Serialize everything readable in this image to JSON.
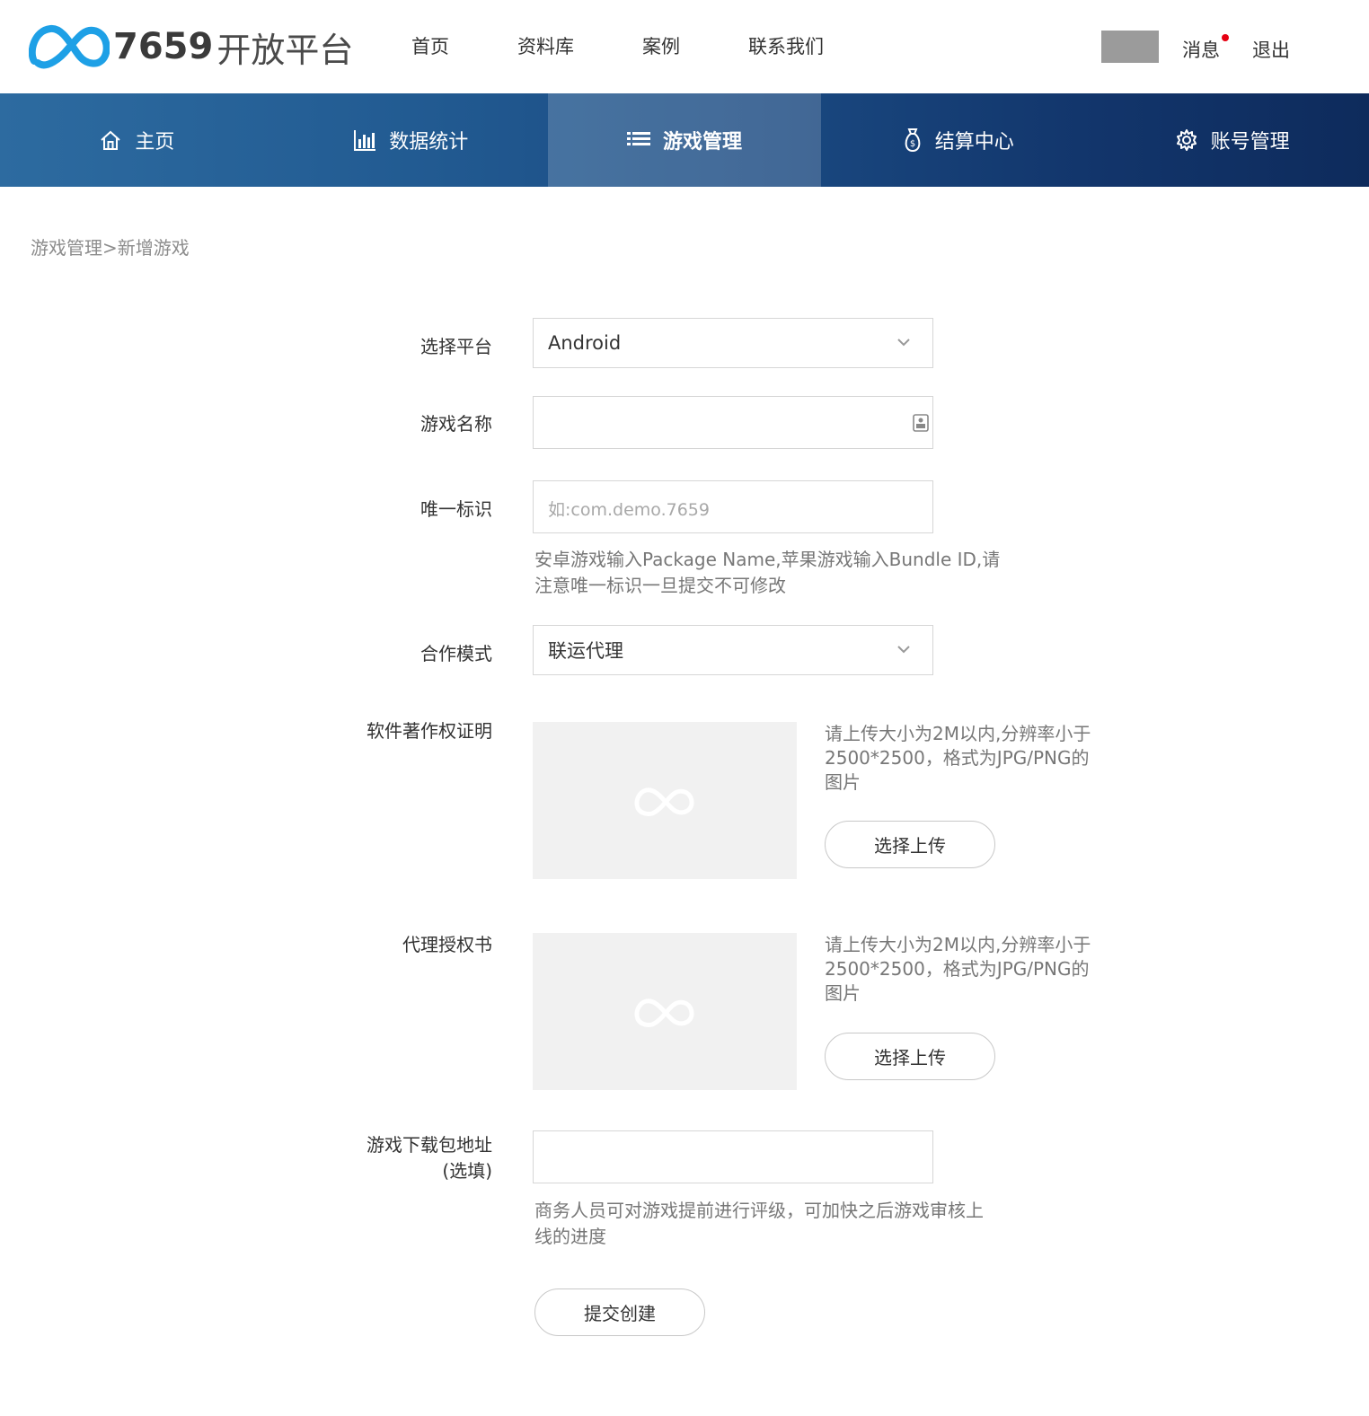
{
  "brand": {
    "logo_number": "7659",
    "logo_text": "开放平台",
    "logo_color": "#1ea0e6"
  },
  "topnav": [
    "首页",
    "资料库",
    "案例",
    "联系我们"
  ],
  "user": {
    "messages_label": "消息",
    "logout_label": "退出",
    "notification_dot_color": "#e60012"
  },
  "mainnav": [
    {
      "label": "主页",
      "icon": "home-icon"
    },
    {
      "label": "数据统计",
      "icon": "bar-chart-icon"
    },
    {
      "label": "游戏管理",
      "icon": "list-icon",
      "active": true
    },
    {
      "label": "结算中心",
      "icon": "money-bag-icon"
    },
    {
      "label": "账号管理",
      "icon": "gear-icon"
    }
  ],
  "breadcrumb": "游戏管理>新增游戏",
  "form": {
    "platform": {
      "label": "选择平台",
      "value": "Android"
    },
    "game_name": {
      "label": "游戏名称",
      "value": ""
    },
    "unique_id": {
      "label": "唯一标识",
      "placeholder": "如:com.demo.7659",
      "hint_line1": "安卓游戏输入Package Name,苹果游戏输入Bundle ID,请",
      "hint_line2": "注意唯一标识一旦提交不可修改"
    },
    "coop_mode": {
      "label": "合作模式",
      "value": "联运代理"
    },
    "copyright": {
      "label": "软件著作权证明",
      "hint_line1": "请上传大小为2M以内,分辨率小于",
      "hint_line2": "2500*2500，格式为JPG/PNG的",
      "hint_line3": "图片",
      "button": "选择上传"
    },
    "authorization": {
      "label": "代理授权书",
      "hint_line1": "请上传大小为2M以内,分辨率小于",
      "hint_line2": "2500*2500，格式为JPG/PNG的",
      "hint_line3": "图片",
      "button": "选择上传"
    },
    "download_url": {
      "label_line1": "游戏下载包地址",
      "label_line2": "(选填)",
      "value": "",
      "hint_line1": "商务人员可对游戏提前进行评级，可加快之后游戏审核上",
      "hint_line2": "线的进度"
    },
    "submit": "提交创建"
  }
}
